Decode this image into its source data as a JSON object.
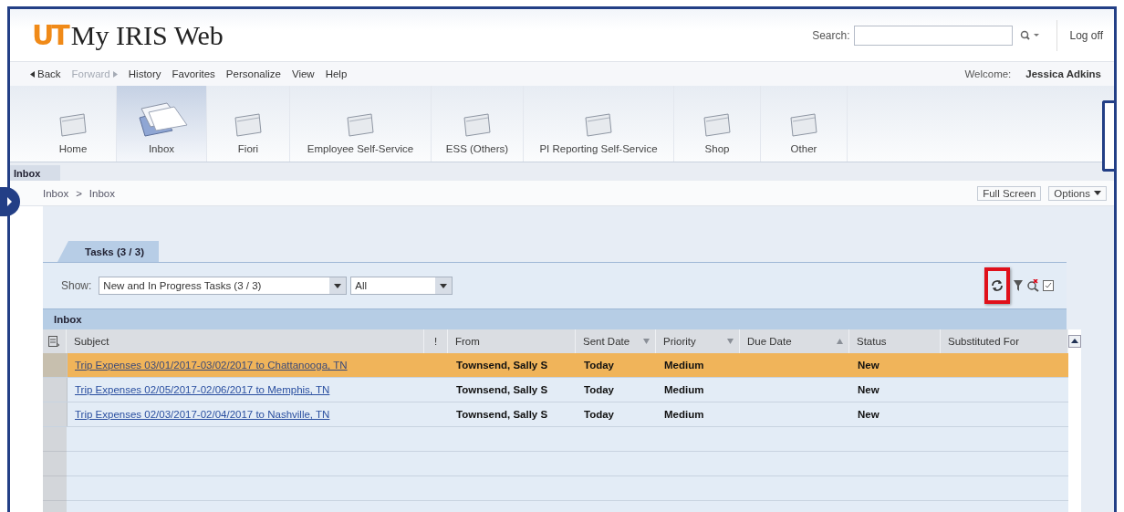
{
  "header": {
    "logo_mark": "UT",
    "title": "My IRIS Web",
    "search_label": "Search:",
    "logoff": "Log off"
  },
  "nav": {
    "items": [
      {
        "label": "Back",
        "kind": "back",
        "disabled": false
      },
      {
        "label": "Forward",
        "kind": "forward",
        "disabled": true
      },
      {
        "label": "History",
        "kind": "link",
        "disabled": false
      },
      {
        "label": "Favorites",
        "kind": "link",
        "disabled": false
      },
      {
        "label": "Personalize",
        "kind": "link",
        "disabled": false
      },
      {
        "label": "View",
        "kind": "link",
        "disabled": false
      },
      {
        "label": "Help",
        "kind": "link",
        "disabled": false
      }
    ],
    "welcome_label": "Welcome:",
    "user": "Jessica Adkins"
  },
  "launchpad": [
    {
      "label": "Home",
      "selected": false
    },
    {
      "label": "Inbox",
      "selected": true
    },
    {
      "label": "Fiori",
      "selected": false
    },
    {
      "label": "Employee Self-Service",
      "selected": false
    },
    {
      "label": "ESS (Others)",
      "selected": false
    },
    {
      "label": "PI Reporting Self-Service",
      "selected": false
    },
    {
      "label": "Shop",
      "selected": false
    },
    {
      "label": "Other",
      "selected": false
    }
  ],
  "page_tab": "Inbox",
  "breadcrumb": {
    "items": [
      "Inbox",
      "Inbox"
    ],
    "separator": ">"
  },
  "page_buttons": [
    {
      "label": "Full Screen",
      "kind": "plain"
    },
    {
      "label": "Options",
      "kind": "menu"
    }
  ],
  "tasks_tab": "Tasks  (3 / 3)",
  "filter": {
    "label": "Show:",
    "dropdowns": [
      {
        "value": "New and In Progress Tasks  (3 / 3)"
      },
      {
        "value": "All"
      }
    ]
  },
  "toolbar_icons": [
    {
      "kind": "refresh",
      "highlighted": true
    },
    {
      "kind": "filter",
      "highlighted": false
    },
    {
      "kind": "clear-search",
      "highlighted": false
    },
    {
      "kind": "settings",
      "highlighted": false
    }
  ],
  "table": {
    "title": "Inbox",
    "columns": [
      {
        "label": "Subject",
        "sorted": false
      },
      {
        "label": "!",
        "sorted": false
      },
      {
        "label": "From",
        "sorted": false
      },
      {
        "label": "Sent Date",
        "sorted": true,
        "ascending": false
      },
      {
        "label": "Priority",
        "sorted": true,
        "ascending": false
      },
      {
        "label": "Due Date",
        "sorted": true,
        "ascending": true
      },
      {
        "label": "Status",
        "sorted": false
      },
      {
        "label": "Substituted For",
        "sorted": false
      }
    ],
    "rows": [
      {
        "subject": "Trip Expenses 03/01/2017-03/02/2017 to Chattanooga, TN",
        "from": "Townsend, Sally S",
        "sent_date": "Today",
        "priority": "Medium",
        "status": "New",
        "selected": true
      },
      {
        "subject": "Trip Expenses 02/05/2017-02/06/2017 to Memphis, TN",
        "from": "Townsend, Sally S",
        "sent_date": "Today",
        "priority": "Medium",
        "status": "New",
        "selected": false
      },
      {
        "subject": "Trip Expenses 02/03/2017-02/04/2017 to Nashville, TN",
        "from": "Townsend, Sally S",
        "sent_date": "Today",
        "priority": "Medium",
        "status": "New",
        "selected": false
      }
    ]
  }
}
